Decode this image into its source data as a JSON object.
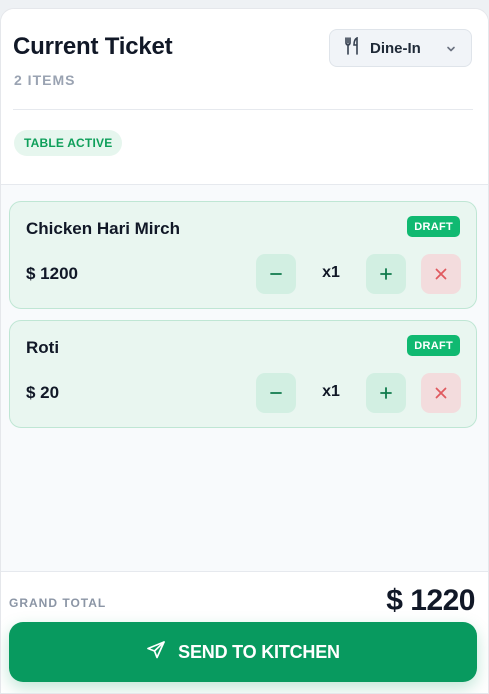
{
  "header": {
    "title": "Current Ticket",
    "item_count": "2 ITEMS",
    "order_type": {
      "label": "Dine-In",
      "icon": "utensils-icon"
    },
    "status_badge": "TABLE ACTIVE"
  },
  "items": [
    {
      "name": "Chicken Hari Mirch",
      "price": "$ 1200",
      "quantity": "x1",
      "status": "DRAFT"
    },
    {
      "name": "Roti",
      "price": "$ 20",
      "quantity": "x1",
      "status": "DRAFT"
    }
  ],
  "footer": {
    "grand_total_label": "GRAND TOTAL",
    "grand_total_value": "$ 1220",
    "send_button_label": "SEND TO KITCHEN",
    "send_icon": "paper-plane-icon"
  },
  "colors": {
    "accent": "#089a5f",
    "draft_badge": "#10b971",
    "remove_button": "#f3dcdd",
    "card_bg": "#e9f6f0"
  }
}
